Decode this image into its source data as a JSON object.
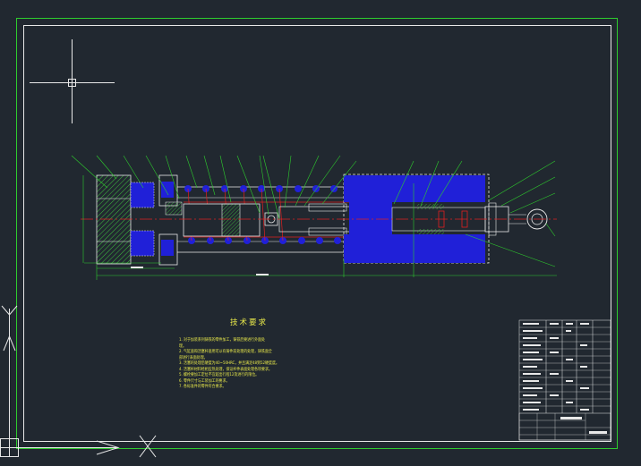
{
  "drawing": {
    "notes_title": "技术要求",
    "notes": [
      "1. 对于加装系列铸铁的零件加工，铸铁后要进行外面处",
      "理。",
      "2. 气缸座和活塞杆座用可以有铸件前处理的处理，铸铁面全",
      "部进行表面处理。",
      "3. 活塞的处理后硬度为40~50HRC，并且满足48到52硬度度。",
      "4. 活塞杆材料经相应热处理，保证杆件表面处理各项要求。",
      "5. 螺栓要加工定位不宜超出行程12及进行的限位。",
      "6. 零件尺寸与工装加工的要求。",
      "7. 各标准件的零件符合要求。"
    ]
  },
  "colors": {
    "background": "#212830",
    "frame": "#2ecc2e",
    "border": "#e8e8e8",
    "text": "#e8e84a",
    "part": "#2020d8",
    "hatch": "#3fbf3f"
  }
}
